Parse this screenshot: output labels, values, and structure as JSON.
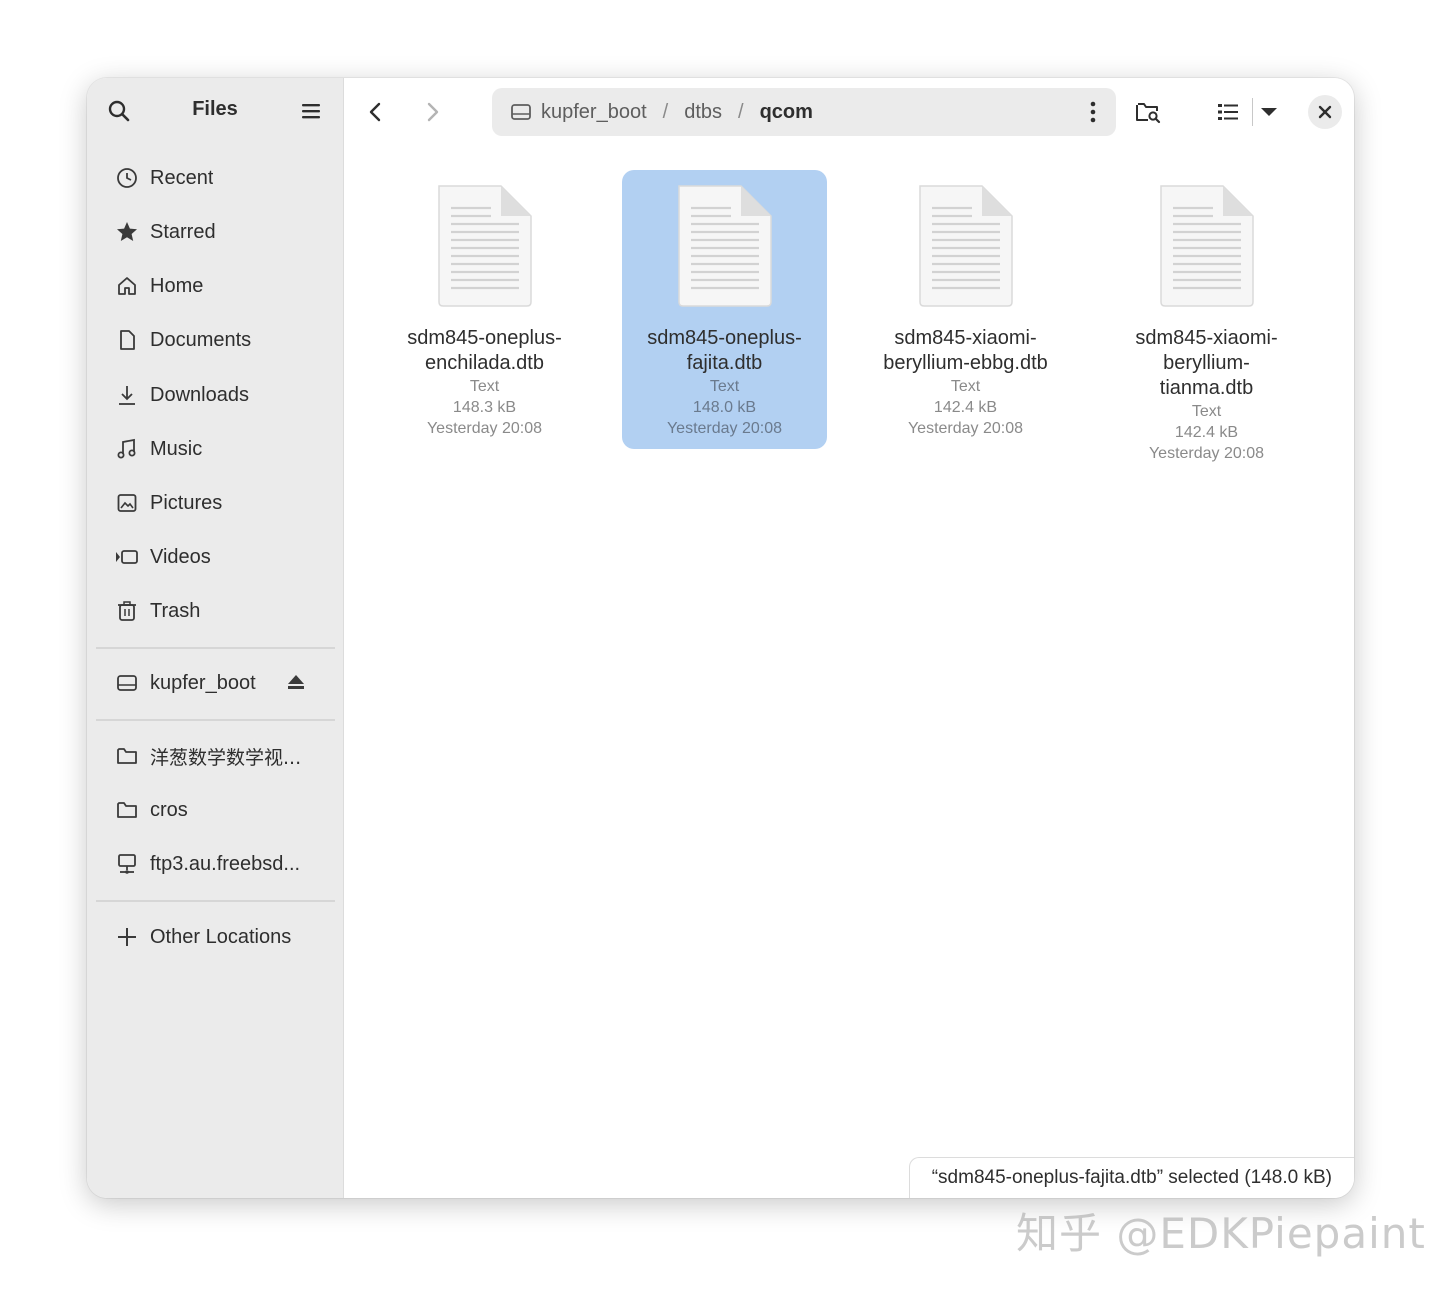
{
  "sidebar": {
    "title": "Files",
    "places": [
      {
        "label": "Recent",
        "icon": "clock-icon"
      },
      {
        "label": "Starred",
        "icon": "star-icon"
      },
      {
        "label": "Home",
        "icon": "home-icon"
      },
      {
        "label": "Documents",
        "icon": "document-icon"
      },
      {
        "label": "Downloads",
        "icon": "download-icon"
      },
      {
        "label": "Music",
        "icon": "music-icon"
      },
      {
        "label": "Pictures",
        "icon": "picture-icon"
      },
      {
        "label": "Videos",
        "icon": "video-icon"
      },
      {
        "label": "Trash",
        "icon": "trash-icon"
      }
    ],
    "devices": [
      {
        "label": "kupfer_boot",
        "icon": "drive-icon"
      }
    ],
    "bookmarks": [
      {
        "label": "洋葱数学数学视...",
        "icon": "folder-icon"
      },
      {
        "label": "cros",
        "icon": "folder-icon"
      },
      {
        "label": "ftp3.au.freebsd...",
        "icon": "network-icon"
      }
    ],
    "other_locations": "Other Locations"
  },
  "path": {
    "crumbs": [
      "kupfer_boot",
      "dtbs",
      "qcom"
    ],
    "separator": "/"
  },
  "files": [
    {
      "name": "sdm845-oneplus-enchilada.dtb",
      "type": "Text",
      "size": "148.3 kB",
      "modified": "Yesterday 20:08",
      "selected": false
    },
    {
      "name": "sdm845-oneplus-fajita.dtb",
      "type": "Text",
      "size": "148.0 kB",
      "modified": "Yesterday 20:08",
      "selected": true
    },
    {
      "name": "sdm845-xiaomi-beryllium-ebbg.dtb",
      "type": "Text",
      "size": "142.4 kB",
      "modified": "Yesterday 20:08",
      "selected": false
    },
    {
      "name": "sdm845-xiaomi-beryllium-tianma.dtb",
      "type": "Text",
      "size": "142.4 kB",
      "modified": "Yesterday 20:08",
      "selected": false
    }
  ],
  "file_names_display": [
    [
      "sdm845-oneplus-",
      "enchilada.dtb"
    ],
    [
      "sdm845-oneplus-",
      "fajita.dtb"
    ],
    [
      "sdm845-xiaomi-",
      "beryllium-ebbg.dtb"
    ],
    [
      "sdm845-xiaomi-",
      "beryllium-",
      "tianma.dtb"
    ]
  ],
  "status": "“sdm845-oneplus-fajita.dtb” selected  (148.0 kB)",
  "watermark": "知乎 @EDKPiepaint",
  "colors": {
    "sidebar_bg": "#ebebeb",
    "selection": "#b2d0f2",
    "text": "#2e2e2e",
    "muted": "#8a8a8a"
  }
}
